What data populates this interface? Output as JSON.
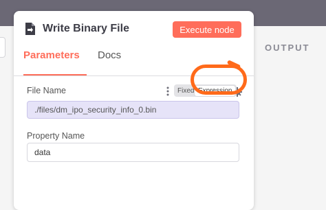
{
  "output": {
    "label": "OUTPUT"
  },
  "node": {
    "title": "Write Binary File",
    "execute_label": "Execute node"
  },
  "tabs": [
    {
      "label": "Parameters",
      "active": true
    },
    {
      "label": "Docs",
      "active": false
    }
  ],
  "fields": {
    "file_name": {
      "label": "File Name",
      "mode_fixed": "Fixed",
      "mode_expression": "Expression",
      "value": "./files/dm_ipo_security_info_0.bin"
    },
    "property_name": {
      "label": "Property Name",
      "value": "data"
    }
  },
  "colors": {
    "accent": "#ff6d5a",
    "annotation": "#ff6a1a",
    "expression_bg": "#e6e3f8",
    "topbar": "#6b6875"
  },
  "icons": [
    "write-file-icon",
    "gear-icon",
    "more-options-icon"
  ]
}
